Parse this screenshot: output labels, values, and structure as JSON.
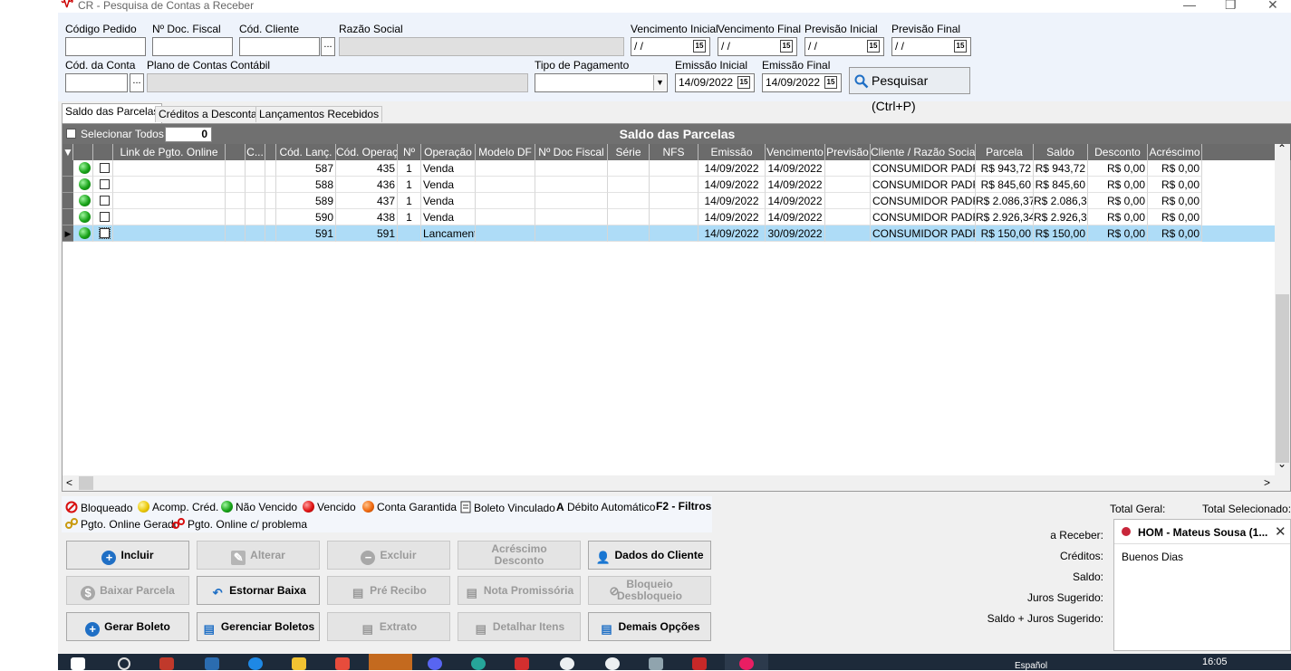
{
  "window": {
    "title": "CR - Pesquisa de Contas a Receber",
    "minimize": "—",
    "maximize": "❐",
    "close": "✕"
  },
  "filters": {
    "codigo_pedido": "Código Pedido",
    "nr_doc_fiscal": "Nº Doc. Fiscal",
    "cod_cliente": "Cód. Cliente",
    "razao_social": "Razão Social",
    "venc_inicial": "Vencimento Inicial",
    "venc_final": "Vencimento Final",
    "prev_inicial": "Previsão Inicial",
    "prev_final": "Previsão Final",
    "cod_conta": "Cód. da Conta",
    "plano_contas": "Plano de Contas Contábil",
    "tipo_pagamento": "Tipo de Pagamento",
    "emissao_inicial": "Emissão Inicial",
    "emissao_final": "Emissão Final",
    "empty_date": " / /",
    "emissao_inicial_value": "14/09/2022",
    "emissao_final_value": "14/09/2022",
    "dots_label": "...",
    "cal_label": "15",
    "dropdown_arrow": "▼",
    "search_button": "Pesquisar (Ctrl+P)"
  },
  "tabs": [
    {
      "label": "Saldo das Parcelas",
      "active": true
    },
    {
      "label": "Créditos a Descontar",
      "active": false
    },
    {
      "label": "Lançamentos Recebidos",
      "active": false
    }
  ],
  "grid": {
    "title": "Saldo das Parcelas",
    "select_all": "Selecionar Todos",
    "selected_count": "0",
    "columns": [
      "▼",
      "",
      "",
      "Link de Pgto. Online",
      "",
      "C...",
      "",
      "Cód. Lanç.",
      "Cód. Operação",
      "Nº",
      "Operação",
      "Modelo DF",
      "Nº Doc Fiscal",
      "Série",
      "NFS",
      "Emissão",
      "Vencimento",
      "Previsão",
      "Cliente / Razão Social",
      "Parcela",
      "Saldo",
      "Desconto",
      "Acréscimo"
    ],
    "rows": [
      {
        "cod_lanc": "587",
        "cod_op": "435",
        "nr": "1",
        "operacao": "Venda",
        "emissao": "14/09/2022",
        "vencimento": "14/09/2022",
        "cliente": "CONSUMIDOR PADRAO",
        "parcela": "R$ 943,72",
        "saldo": "R$ 943,72",
        "desconto": "R$ 0,00",
        "acrescimo": "R$ 0,00"
      },
      {
        "cod_lanc": "588",
        "cod_op": "436",
        "nr": "1",
        "operacao": "Venda",
        "emissao": "14/09/2022",
        "vencimento": "14/09/2022",
        "cliente": "CONSUMIDOR PADRAO",
        "parcela": "R$ 845,60",
        "saldo": "R$ 845,60",
        "desconto": "R$ 0,00",
        "acrescimo": "R$ 0,00"
      },
      {
        "cod_lanc": "589",
        "cod_op": "437",
        "nr": "1",
        "operacao": "Venda",
        "emissao": "14/09/2022",
        "vencimento": "14/09/2022",
        "cliente": "CONSUMIDOR PADRAO",
        "parcela": "R$ 2.086,37",
        "saldo": "R$ 2.086,37",
        "desconto": "R$ 0,00",
        "acrescimo": "R$ 0,00"
      },
      {
        "cod_lanc": "590",
        "cod_op": "438",
        "nr": "1",
        "operacao": "Venda",
        "emissao": "14/09/2022",
        "vencimento": "14/09/2022",
        "cliente": "CONSUMIDOR PADRAO",
        "parcela": "R$ 2.926,34",
        "saldo": "R$ 2.926,34",
        "desconto": "R$ 0,00",
        "acrescimo": "R$ 0,00"
      },
      {
        "cod_lanc": "591",
        "cod_op": "591",
        "nr": "",
        "operacao": "Lancamento",
        "emissao": "14/09/2022",
        "vencimento": "30/09/2022",
        "cliente": "CONSUMIDOR PADRAO",
        "parcela": "R$ 150,00",
        "saldo": "R$ 150,00",
        "desconto": "R$ 0,00",
        "acrescimo": "R$ 0,00"
      }
    ],
    "selected_row_index": 4,
    "row_pointer": "▶",
    "scroll_up": "⌃",
    "scroll_down": "⌄",
    "scroll_left": "<",
    "scroll_right": ">"
  },
  "legend": {
    "bloqueado": "Bloqueado",
    "acomp_cred": "Acomp. Créd.",
    "nao_vencido": "Não Vencido",
    "vencido": "Vencido",
    "conta_garantida": "Conta Garantida",
    "boleto_vinculado": "Boleto Vinculado",
    "debito_auto_letter": "A",
    "debito_automatico": "Débito Automático",
    "f2_filtros": "F2 - Filtros",
    "pgto_online_gerado": "Pgto. Online Gerado",
    "pgto_online_problema": "Pgto. Online c/ problema"
  },
  "actions": {
    "incluir": "Incluir",
    "alterar": "Alterar",
    "excluir": "Excluir",
    "acrescimo_1": "Acréscimo",
    "acrescimo_2": "Desconto",
    "dados_cliente": "Dados do Cliente",
    "baixar_parcela": "Baixar Parcela",
    "estornar_baixa": "Estornar Baixa",
    "pre_recibo": "Pré Recibo",
    "nota_promissoria": "Nota Promissória",
    "bloqueio_1": "Bloqueio",
    "bloqueio_2": "Desbloqueio",
    "gerar_boleto": "Gerar Boleto",
    "gerenciar_boletos": "Gerenciar Boletos",
    "extrato": "Extrato",
    "detalhar_itens": "Detalhar Itens",
    "demais_opcoes": "Demais Opções"
  },
  "totals": {
    "total_geral": "Total Geral:",
    "total_selecionado": "Total Selecionado:",
    "a_receber": "a Receber:",
    "creditos": "Créditos:",
    "saldo": "Saldo:",
    "juros_sugerido": "Juros Sugerido:",
    "saldo_juros": "Saldo + Juros Sugerido:"
  },
  "chat_popup": {
    "title": "HOM - Mateus Sousa (1...",
    "message": "Buenos Dias",
    "close": "✕"
  },
  "taskbar": {
    "time": "16:05",
    "locale": "Español"
  },
  "colors": {
    "grid_header": "#6b6b6b",
    "selected_row": "#aedcf7",
    "filter_bg": "#eef3fb",
    "taskbar": "#1d2a3a",
    "accent_blue": "#1f6fc5"
  }
}
